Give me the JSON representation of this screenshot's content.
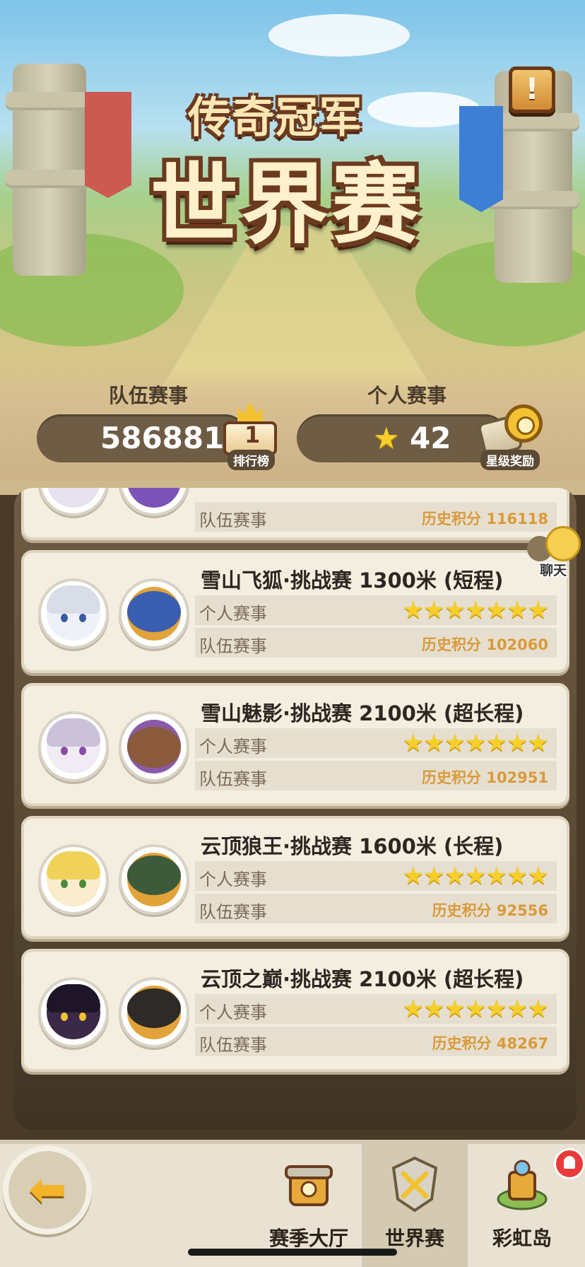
{
  "header": {
    "title_top": "传奇冠军",
    "title_main": "世界赛",
    "info_icon": "scroll-info-icon"
  },
  "stats": {
    "team": {
      "label": "队伍赛事",
      "value": "586881",
      "icon_caption": "排行榜",
      "icon_number": "1"
    },
    "personal": {
      "label": "个人赛事",
      "value": "42",
      "star": "★",
      "icon_caption": "星级奖励"
    }
  },
  "chat": {
    "label": "聊天"
  },
  "cards": [
    {
      "title": "",
      "team_label": "队伍赛事",
      "score": "历史积分 116118",
      "partial": true
    },
    {
      "title": "雪山飞狐·挑战赛 1300米 (短程)",
      "personal_label": "个人赛事",
      "team_label": "队伍赛事",
      "stars": "★★★★★★★",
      "score": "历史积分 102060"
    },
    {
      "title": "雪山魅影·挑战赛 2100米 (超长程)",
      "personal_label": "个人赛事",
      "team_label": "队伍赛事",
      "stars": "★★★★★★★",
      "score": "历史积分 102951"
    },
    {
      "title": "云顶狼王·挑战赛 1600米 (长程)",
      "personal_label": "个人赛事",
      "team_label": "队伍赛事",
      "stars": "★★★★★★★",
      "score": "历史积分 92556"
    },
    {
      "title": "云顶之巅·挑战赛 2100米 (超长程)",
      "personal_label": "个人赛事",
      "team_label": "队伍赛事",
      "stars": "★★★★★★★",
      "score": "历史积分 48267"
    }
  ],
  "nav": {
    "back_arrow": "⬅",
    "items": [
      {
        "label": "赛季大厅",
        "icon": "season-hall-icon"
      },
      {
        "label": "世界赛",
        "icon": "world-cup-icon",
        "active": true
      },
      {
        "label": "彩虹岛",
        "icon": "rainbow-island-icon"
      }
    ]
  },
  "colors": {
    "score_text": "#d99a3a",
    "star": "#f6cf2a",
    "panel": "#6a5640",
    "card_bg": "#f4eee0"
  }
}
